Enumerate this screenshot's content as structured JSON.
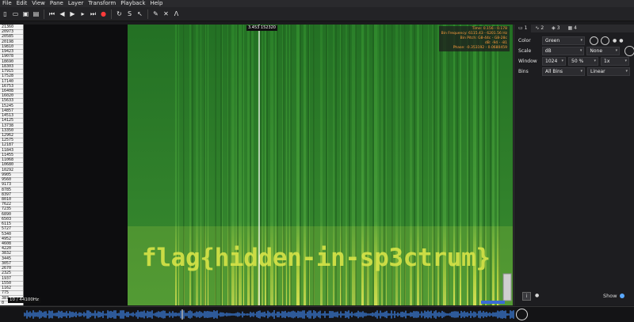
{
  "menu": [
    "File",
    "Edit",
    "View",
    "Pane",
    "Layer",
    "Transform",
    "Playback",
    "Help"
  ],
  "toolbar_icons": [
    "new-icon",
    "open-icon",
    "save-icon",
    "save-as-icon",
    "rewind-start-icon",
    "rewind-icon",
    "play-pause-icon",
    "fast-forward-icon",
    "ffwd-end-icon",
    "record-icon",
    "loop-icon",
    "select-icon",
    "navigate-icon",
    "draw-icon",
    "erase-icon",
    "measure-icon"
  ],
  "ruler_ticks": [
    "21360",
    "20973",
    "20585",
    "20198",
    "19810",
    "19423",
    "19078",
    "18690",
    "18303",
    "17915",
    "17528",
    "17140",
    "16753",
    "16408",
    "16020",
    "15633",
    "15245",
    "14857",
    "14513",
    "14125",
    "13738",
    "13350",
    "12962",
    "12575",
    "12187",
    "11843",
    "11455",
    "11068",
    "10680",
    "10292",
    "9905",
    "9560",
    "9173",
    "8785",
    "8397",
    "8010",
    "7622",
    "7235",
    "6890",
    "6503",
    "6115",
    "5727",
    "5340",
    "4952",
    "4608",
    "4220",
    "3832",
    "3445",
    "3057",
    "2670",
    "2325",
    "1937",
    "1550",
    "1162",
    "775",
    "387",
    "0"
  ],
  "freq_label": "10 / 44100Hz",
  "cursor_label": "3.453 152320",
  "info": {
    "time": "Time: 0.156 - 0.178",
    "bin_freq": "Bin Frequency: 6115.43 - 6201.56 Hz",
    "bin_pitch": "Bin Pitch: G8-44c - G8-28c",
    "db": "dB: -94 - -81",
    "phase": "Phase: -0.353192 - 0.0680459"
  },
  "hidden_text": "flag{hidden-in-sp3ctrum}",
  "panel": {
    "tabs": [
      "1",
      "2",
      "3",
      "4"
    ],
    "color_label": "Color",
    "color_value": "Green",
    "scale_label": "Scale",
    "scale_value": "dB",
    "scale_value2": "None",
    "window_label": "Window",
    "window_value": "1024",
    "window_overlap": "50 %",
    "window_zoom": "1x",
    "bins_label": "Bins",
    "bins_value": "All Bins",
    "bins_scale": "Linear",
    "show_label": "Show"
  }
}
